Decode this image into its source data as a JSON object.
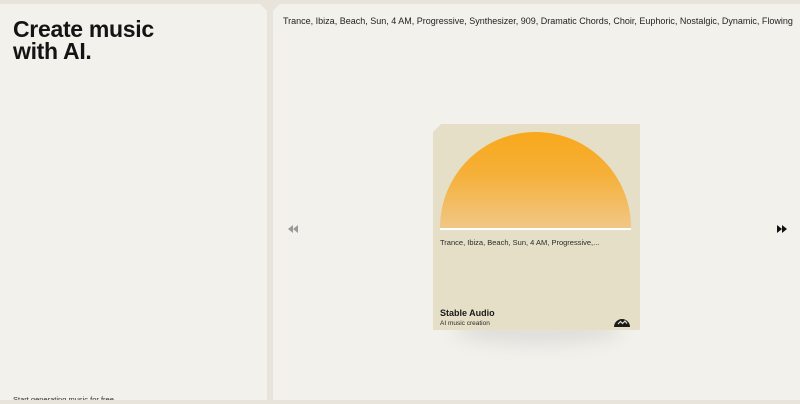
{
  "hero": {
    "title_line1": "Create music",
    "title_line2": "with AI.",
    "cta": "Start generating music for free"
  },
  "prompt": {
    "text": "Trance, Ibiza, Beach, Sun, 4 AM, Progressive, Synthesizer, 909, Dramatic Chords, Choir, Euphoric, Nostalgic, Dynamic, Flowing"
  },
  "card": {
    "prompt_preview": "Trance, Ibiza, Beach, Sun, 4 AM, Progressive,...",
    "title": "Stable Audio",
    "subtitle": "AI music creation",
    "sun_color_top": "#f8a81b",
    "sun_color_bottom": "#f1c786",
    "background_color": "#e5dfc7"
  },
  "nav": {
    "prev_icon": "rewind-icon",
    "next_icon": "fast-forward-icon"
  }
}
